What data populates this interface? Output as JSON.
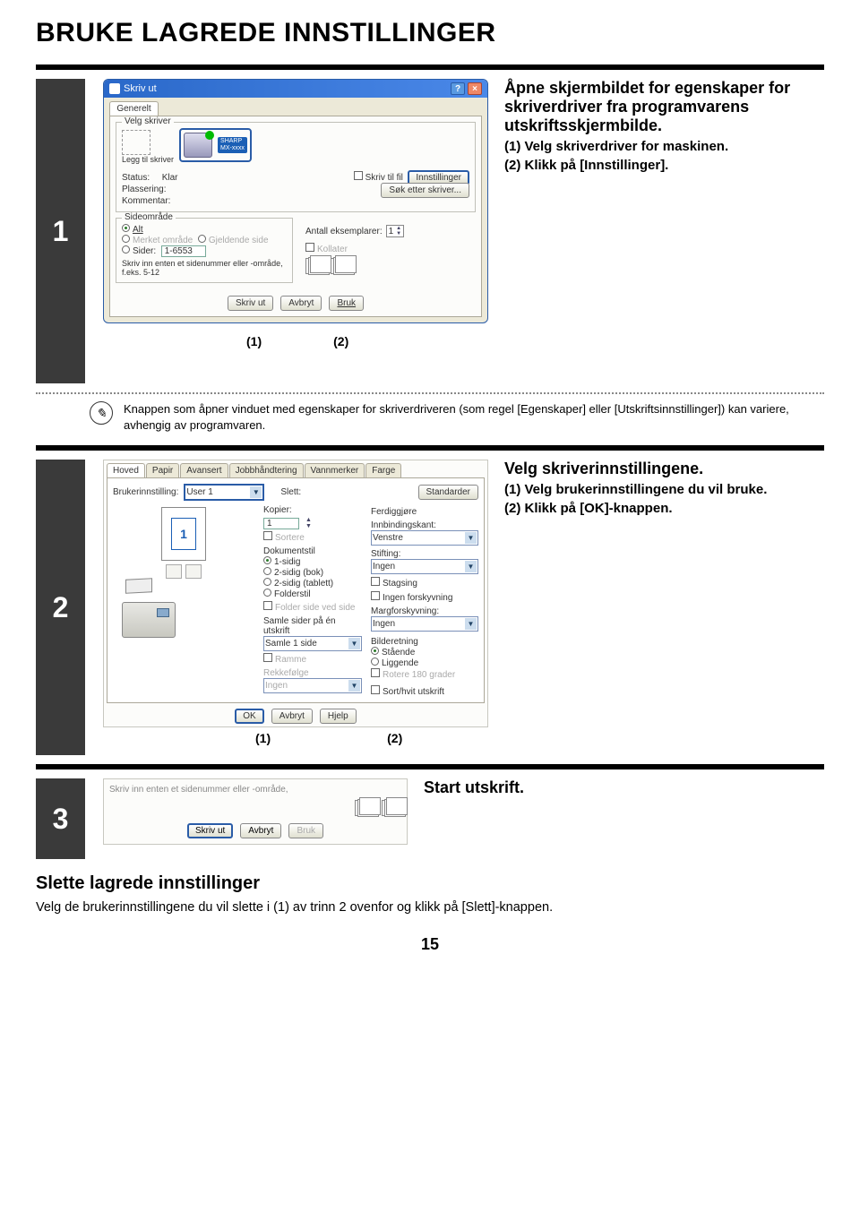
{
  "page_title": "BRUKE LAGREDE INNSTILLINGER",
  "step1": {
    "num": "1",
    "heading": "Åpne skjermbildet for egenskaper for skriverdriver fra programvarens utskriftsskjermbilde.",
    "i1": "(1) Velg skriverdriver for maskinen.",
    "i2": "(2) Klikk på [Innstillinger].",
    "annot1": "(1)",
    "annot2": "(2)",
    "dialog": {
      "title": "Skriv ut",
      "tab": "Generelt",
      "group_velg": "Velg skriver",
      "add_printer": "Legg til skriver",
      "brand": "SHARP",
      "model": "MX-xxxx",
      "status_lbl": "Status:",
      "status_val": "Klar",
      "plassering": "Plassering:",
      "kommentar": "Kommentar:",
      "skriv_fil": "Skriv til fil",
      "innstillinger": "Innstillinger",
      "sok": "Søk etter skriver...",
      "side_group": "Sideområde",
      "alt": "Alt",
      "merket": "Merket område",
      "gjeldende": "Gjeldende side",
      "sider": "Sider:",
      "sider_val": "1-6553",
      "hint": "Skriv inn enten et sidenummer eller -område, f.eks. 5-12",
      "eksemplarer": "Antall eksemplarer:",
      "eks_val": "1",
      "kollater": "Kollater",
      "btn_skriv": "Skriv ut",
      "btn_avbryt": "Avbryt",
      "btn_bruk": "Bruk"
    },
    "note": "Knappen som åpner vinduet med egenskaper for skriverdriveren (som regel [Egenskaper] eller [Utskriftsinnstillinger]) kan variere, avhengig av programvaren."
  },
  "step2": {
    "num": "2",
    "heading": "Velg skriverinnstillingene.",
    "i1": "(1) Velg brukerinnstillingene du vil bruke.",
    "i2": "(2) Klikk på [OK]-knappen.",
    "annot1": "(1)",
    "annot2": "(2)",
    "dialog": {
      "tabs": [
        "Hoved",
        "Papir",
        "Avansert",
        "Jobbhåndtering",
        "Vannmerker",
        "Farge"
      ],
      "bruker_lbl": "Brukerinnstilling:",
      "bruker_val": "User 1",
      "slett": "Slett:",
      "standarder": "Standarder",
      "kopier_lbl": "Kopier:",
      "kopier_val": "1",
      "sorter": "Sortere",
      "dokstil": "Dokumentstil",
      "r1": "1-sidig",
      "r2": "2-sidig (bok)",
      "r3": "2-sidig (tablett)",
      "r4": "Folderstil",
      "folder_side": "Folder side ved side",
      "samle_lbl": "Samle sider på én utskrift",
      "samle_val": "Samle 1 side",
      "ramme": "Ramme",
      "rekkefolge": "Rekkefølge",
      "ingen": "Ingen",
      "ferdig_lbl": "Ferdiggjøre",
      "innbind_lbl": "Innbindingskant:",
      "innbind_val": "Venstre",
      "stift_lbl": "Stifting:",
      "stift_val": "Ingen",
      "stagsing": "Stagsing",
      "ingen_forsk": "Ingen forskyvning",
      "marg_lbl": "Margforskyvning:",
      "marg_val": "Ingen",
      "bild_lbl": "Bilderetning",
      "staande": "Stående",
      "liggende": "Liggende",
      "rotere": "Rotere 180 grader",
      "sort_hvit": "Sort/hvit utskrift",
      "ok": "OK",
      "avbryt": "Avbryt",
      "hjelp": "Hjelp",
      "preview_num": "1"
    }
  },
  "step3": {
    "num": "3",
    "heading": "Start utskrift.",
    "dialog": {
      "hint": "Skriv inn enten et sidenummer eller -område,",
      "btn_skriv": "Skriv ut",
      "btn_avbryt": "Avbryt",
      "btn_bruk": "Bruk"
    }
  },
  "section2": {
    "heading": "Slette lagrede innstillinger",
    "text": "Velg de brukerinnstillingene du vil slette i (1) av trinn 2 ovenfor og klikk på [Slett]-knappen."
  },
  "page_number": "15"
}
